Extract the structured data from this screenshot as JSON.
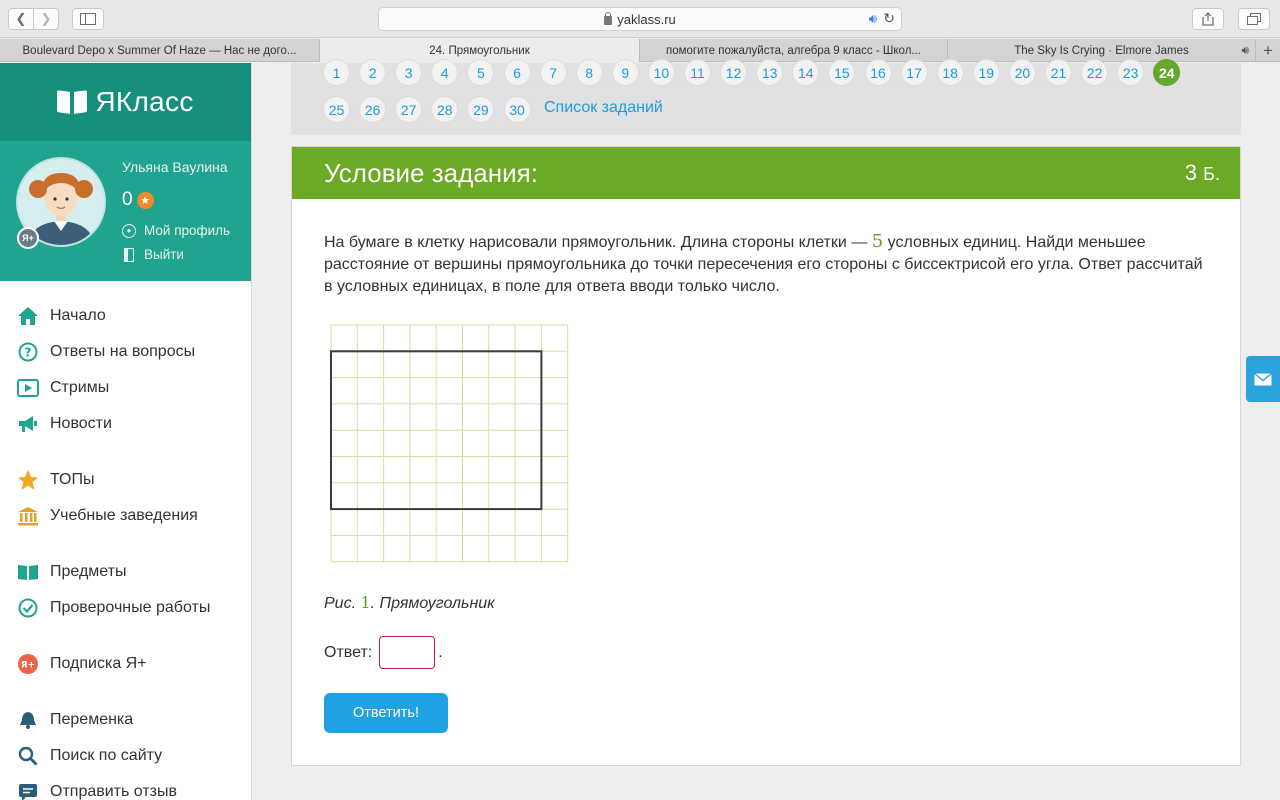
{
  "browser": {
    "url": "yaklass.ru",
    "tabs": [
      {
        "label": "Boulevard Depo x Summer Of Haze — Нас не дого...",
        "active": false
      },
      {
        "label": "24. Прямоугольник",
        "active": true
      },
      {
        "label": "помогите пожалуйста, алгебра 9 класс - Школ...",
        "active": false
      },
      {
        "label": "The Sky Is Crying · Elmore James",
        "active": false
      }
    ]
  },
  "sidebar": {
    "brand": "ЯКласс",
    "user_name": "Ульяна Ваулина",
    "points": "0",
    "badge": "Я+",
    "profile_link": "Мой профиль",
    "logout_link": "Выйти",
    "nav": [
      {
        "label": "Начало",
        "icon": "home-icon"
      },
      {
        "label": "Ответы на вопросы",
        "icon": "question-icon"
      },
      {
        "label": "Стримы",
        "icon": "play-icon"
      },
      {
        "label": "Новости",
        "icon": "megaphone-icon"
      },
      {
        "label": "ТОПы",
        "icon": "star-icon"
      },
      {
        "label": "Учебные заведения",
        "icon": "building-icon"
      },
      {
        "label": "Предметы",
        "icon": "book-icon"
      },
      {
        "label": "Проверочные работы",
        "icon": "check-icon"
      },
      {
        "label": "Подписка Я+",
        "icon": "subscription-icon"
      },
      {
        "label": "Переменка",
        "icon": "bell-icon"
      },
      {
        "label": "Поиск по сайту",
        "icon": "search-icon"
      },
      {
        "label": "Отправить отзыв",
        "icon": "feedback-icon"
      }
    ]
  },
  "tasks": {
    "numbers": [
      "1",
      "2",
      "3",
      "4",
      "5",
      "6",
      "7",
      "8",
      "9",
      "10",
      "11",
      "12",
      "13",
      "14",
      "15",
      "16",
      "17",
      "18",
      "19",
      "20",
      "21",
      "22",
      "23",
      "24",
      "25",
      "26",
      "27",
      "28",
      "29",
      "30"
    ],
    "current": "24",
    "list_link": "Список заданий"
  },
  "task": {
    "title": "Условие задания:",
    "points_value": "3",
    "points_unit": "Б.",
    "text_part1": "На бумаге в клетку нарисовали прямоугольник. Длина стороны клетки — ",
    "cell_size": "5",
    "text_part2": " условных единиц. Найди меньшее расстояние от вершины прямоугольника до точки пересечения его стороны с биссектрисой его угла. Ответ рассчитай в условных единицах, в поле для ответа вводи только число.",
    "figure": {
      "grid_cols": 9,
      "grid_rows": 9,
      "rect": {
        "col_start": 0,
        "row_start": 1,
        "cols": 8,
        "rows": 6
      }
    },
    "caption_prefix": "Рис. ",
    "caption_num": "1",
    "caption_text": ". Прямоугольник",
    "answer_label": "Ответ:",
    "answer_value": "",
    "answer_suffix": ".",
    "submit_label": "Ответить!"
  },
  "colors": {
    "brand": "#168f7c",
    "profile_bg": "#20a48f",
    "header_green": "#6aaa25",
    "link_blue": "#1e9cd7",
    "current_task": "#64a72c",
    "submit": "#1fa2e3",
    "grid_line": "#cfe0a5"
  }
}
